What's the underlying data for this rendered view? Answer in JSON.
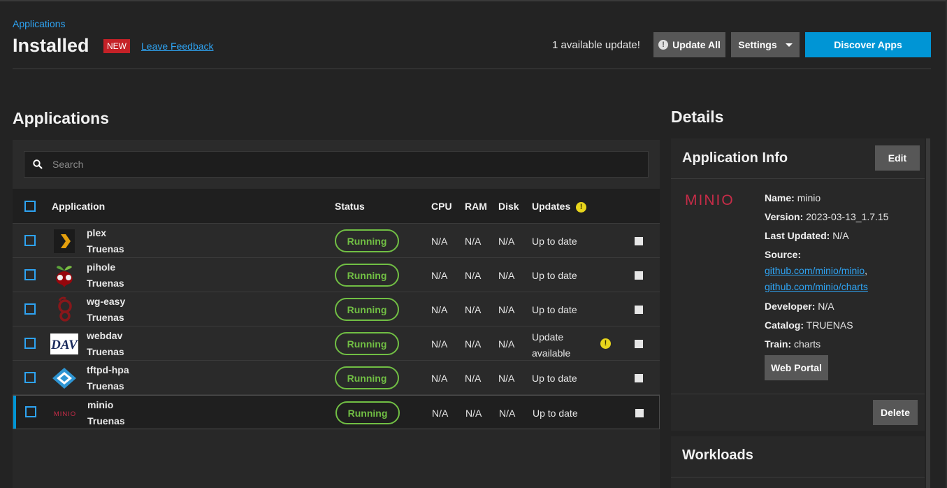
{
  "header": {
    "breadcrumb": "Applications",
    "title": "Installed",
    "new_badge": "NEW",
    "feedback": "Leave Feedback",
    "update_text": "1 available update!",
    "update_all": "Update All",
    "settings": "Settings",
    "discover": "Discover Apps"
  },
  "apps": {
    "title": "Applications",
    "search_placeholder": "Search",
    "columns": {
      "application": "Application",
      "status": "Status",
      "cpu": "CPU",
      "ram": "RAM",
      "disk": "Disk",
      "updates": "Updates"
    },
    "rows": [
      {
        "name": "plex",
        "catalog": "Truenas",
        "status": "Running",
        "cpu": "N/A",
        "ram": "N/A",
        "disk": "N/A",
        "updates": "Up to date",
        "icon": "plex-icon"
      },
      {
        "name": "pihole",
        "catalog": "Truenas",
        "status": "Running",
        "cpu": "N/A",
        "ram": "N/A",
        "disk": "N/A",
        "updates": "Up to date",
        "icon": "pihole-icon"
      },
      {
        "name": "wg-easy",
        "catalog": "Truenas",
        "status": "Running",
        "cpu": "N/A",
        "ram": "N/A",
        "disk": "N/A",
        "updates": "Up to date",
        "icon": "wireguard-icon"
      },
      {
        "name": "webdav",
        "catalog": "Truenas",
        "status": "Running",
        "cpu": "N/A",
        "ram": "N/A",
        "disk": "N/A",
        "updates_line1": "Update",
        "updates_line2": "available",
        "icon": "webdav-icon"
      },
      {
        "name": "tftpd-hpa",
        "catalog": "Truenas",
        "status": "Running",
        "cpu": "N/A",
        "ram": "N/A",
        "disk": "N/A",
        "updates": "Up to date",
        "icon": "tftpd-icon"
      },
      {
        "name": "minio",
        "catalog": "Truenas",
        "status": "Running",
        "cpu": "N/A",
        "ram": "N/A",
        "disk": "N/A",
        "updates": "Up to date",
        "icon": "minio-icon",
        "selected": true
      }
    ]
  },
  "details": {
    "title": "Details",
    "info_title": "Application Info",
    "edit": "Edit",
    "logo_text": "MINIO",
    "name_label": "Name:",
    "name": "minio",
    "version_label": "Version:",
    "version": "2023-03-13_1.7.15",
    "last_updated_label": "Last Updated:",
    "last_updated": "N/A",
    "source_label": "Source:",
    "source1": "github.com/minio/minio",
    "source_sep": ",",
    "source2": "github.com/minio/charts",
    "developer_label": "Developer:",
    "developer": "N/A",
    "catalog_label": "Catalog:",
    "catalog": "TRUENAS",
    "train_label": "Train:",
    "train": "charts",
    "web_portal": "Web Portal",
    "delete": "Delete",
    "workloads_title": "Workloads"
  },
  "colors": {
    "accent": "#0095d5",
    "link": "#2ea3f2",
    "running": "#71bf44",
    "warning": "#e8d51c",
    "badge": "#c42127"
  }
}
